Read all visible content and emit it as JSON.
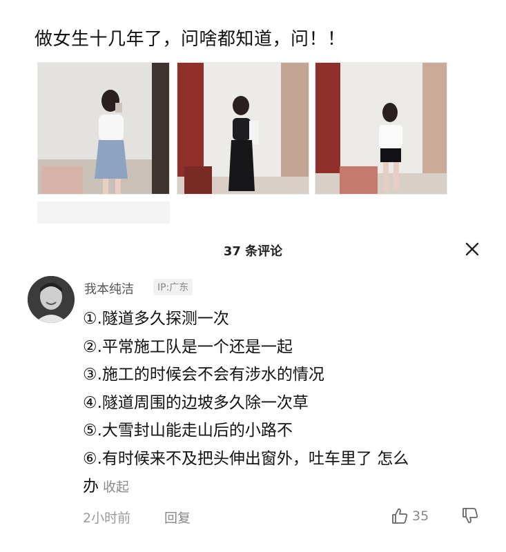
{
  "post": {
    "title": "做女生十几年了，问啥都知道，问！！",
    "photos": [
      {
        "icon": "photo-woman-denim-skirt"
      },
      {
        "icon": "photo-woman-black-pants"
      },
      {
        "icon": "photo-woman-black-shorts"
      }
    ]
  },
  "comments_panel": {
    "header": "37 条评论",
    "close_icon": "close-icon"
  },
  "comment": {
    "username": "我本纯洁",
    "ip_location": "IP:广东",
    "lines": [
      "①.隧道多久探测一次",
      "②.平常施工队是一个还是一起",
      "③.施工的时候会不会有涉水的情况",
      "④.隧道周围的边坡多久除一次草",
      "⑤.大雪封山能走山后的小路不",
      "⑥.有时候来不及把头伸出窗外，吐车里了  怎么",
      "办"
    ],
    "collapse_label": "收起",
    "time": "2小时前",
    "reply_label": "回复",
    "like_count": "35",
    "like_icon": "thumbs-up-icon",
    "dislike_icon": "thumbs-down-icon"
  },
  "colors": {
    "text_primary": "#111111",
    "text_secondary": "#888888",
    "badge_bg": "#f1f1f1"
  }
}
